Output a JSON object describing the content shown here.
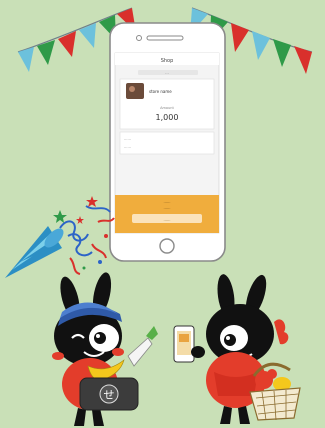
{
  "colors": {
    "background": "#c9e0b7",
    "flag_red": "#d9302c",
    "flag_green": "#2f9a48",
    "flag_blue": "#6cc1dc",
    "phone_frame": "#ffffff",
    "phone_outline": "#8a8a8a",
    "screen_bg": "#f4f4f4",
    "bottom_bar": "#f0ad3d",
    "mascot_black": "#111111",
    "mascot_red": "#e33d2b",
    "cap_blue": "#2f5aa8"
  },
  "phone": {
    "header_title": "Shop",
    "bar_text": "…",
    "store_name": "store name",
    "amount_label": "Amount",
    "amount": "1,000",
    "detail_line_1": "……",
    "detail_line_2": "……",
    "note_line_1": "……",
    "note_line_2": "……",
    "button_label": "……"
  },
  "pot_label": "せ",
  "icons": [
    "bunting-flags",
    "party-popper-icon",
    "smartphone",
    "mascot-shopper",
    "mascot-with-phone",
    "shopping-basket-icon"
  ]
}
